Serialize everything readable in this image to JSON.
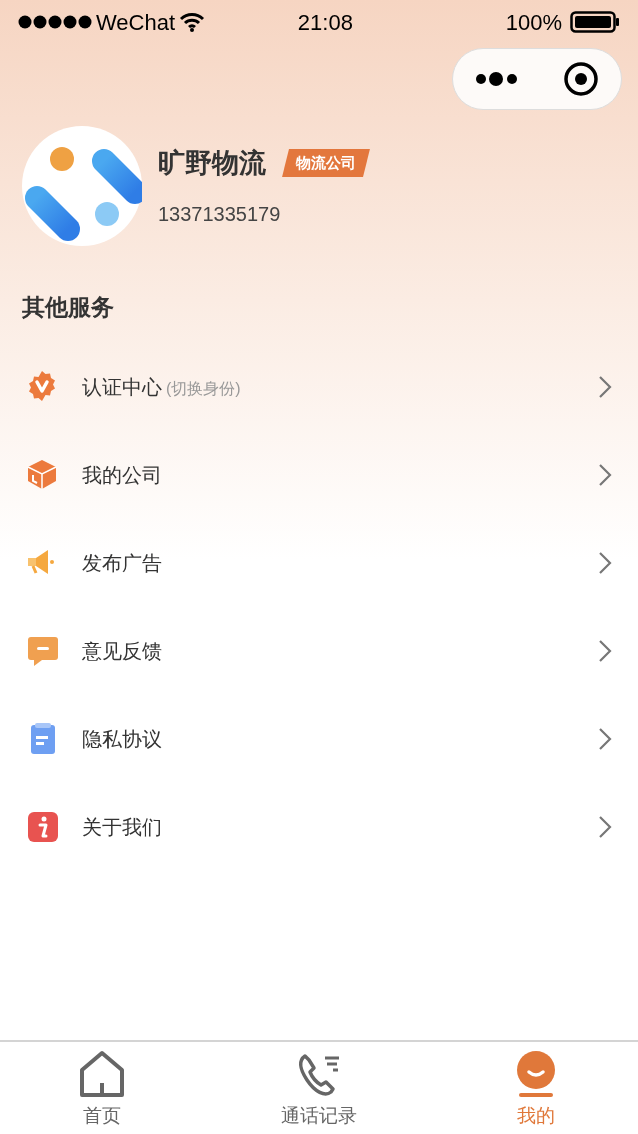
{
  "status_bar": {
    "carrier": "WeChat",
    "time": "21:08",
    "battery": "100%"
  },
  "profile": {
    "name": "旷野物流",
    "tag": "物流公司",
    "phone": "13371335179"
  },
  "section_title": "其他服务",
  "menu": [
    {
      "kind": "badge",
      "label": "认证中心",
      "note": "(切换身份)"
    },
    {
      "kind": "box",
      "label": "我的公司"
    },
    {
      "kind": "megaphone",
      "label": "发布广告"
    },
    {
      "kind": "chat",
      "label": "意见反馈"
    },
    {
      "kind": "doc",
      "label": "隐私协议"
    },
    {
      "kind": "info",
      "label": "关于我们"
    }
  ],
  "tabs": [
    {
      "kind": "home",
      "label": "首页",
      "selected": false
    },
    {
      "kind": "phone",
      "label": "通话记录",
      "selected": false
    },
    {
      "kind": "me",
      "label": "我的",
      "selected": true
    }
  ]
}
